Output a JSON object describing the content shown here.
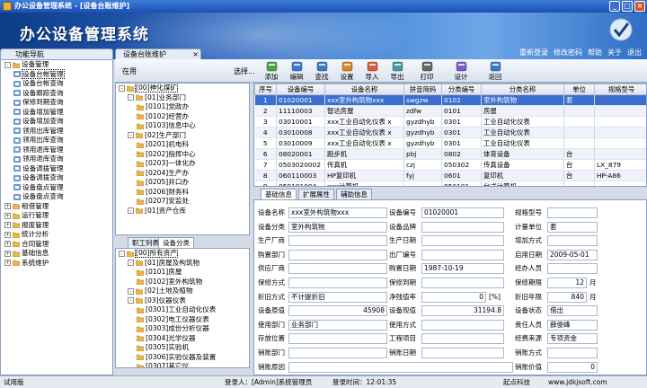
{
  "window": {
    "title": "办公设备管理系统 - [设备台账维护]"
  },
  "banner": {
    "app_title": "办公设备管理系统",
    "nav": [
      "重新登录",
      "修改密码",
      "帮助",
      "关于",
      "退出"
    ]
  },
  "nav": {
    "title": "功能导航",
    "tree": [
      {
        "label": "设备管理",
        "level": 0,
        "exp": "-"
      },
      {
        "label": "设备台帐管理",
        "level": 1,
        "sel": true
      },
      {
        "label": "设备台帐查询",
        "level": 1
      },
      {
        "label": "设备跟踪查询",
        "level": 1
      },
      {
        "label": "保修到期查询",
        "level": 1
      },
      {
        "label": "设备增加管理",
        "level": 1
      },
      {
        "label": "设备增加查询",
        "level": 1
      },
      {
        "label": "领用出库管理",
        "level": 1
      },
      {
        "label": "领用出库查询",
        "level": 1
      },
      {
        "label": "领用退库管理",
        "level": 1
      },
      {
        "label": "领用退库查询",
        "level": 1
      },
      {
        "label": "设备调拨管理",
        "level": 1
      },
      {
        "label": "设备调拨查询",
        "level": 1
      },
      {
        "label": "设备盘点管理",
        "level": 1
      },
      {
        "label": "设备盘点查询",
        "level": 1
      },
      {
        "label": "租借管理",
        "level": 0,
        "exp": "+"
      },
      {
        "label": "运行管理",
        "level": 0,
        "exp": "+"
      },
      {
        "label": "报废管理",
        "level": 0,
        "exp": "+"
      },
      {
        "label": "统计分析",
        "level": 0,
        "exp": "+"
      },
      {
        "label": "合同管理",
        "level": 0,
        "exp": "+"
      },
      {
        "label": "基础信息",
        "level": 0,
        "exp": "+"
      },
      {
        "label": "系统维护",
        "level": 0,
        "exp": "+"
      }
    ]
  },
  "main_tab": "设备台账维护",
  "toolbar": {
    "search_label": "在用",
    "browse": "选择...",
    "tools": [
      "添加",
      "编辑",
      "查找",
      "设置",
      "导入",
      "导出",
      "打印",
      "设计",
      "返回"
    ]
  },
  "dept_tree": [
    {
      "label": "[00]神化煤矿",
      "level": 0,
      "sel": true
    },
    {
      "label": "[01]业务部门",
      "level": 1
    },
    {
      "label": "[0101]党政办",
      "level": 2
    },
    {
      "label": "[0102]经营办",
      "level": 2
    },
    {
      "label": "[0103]信息中心",
      "level": 2
    },
    {
      "label": "[02]生产部门",
      "level": 1
    },
    {
      "label": "[0201]机电科",
      "level": 2
    },
    {
      "label": "[0202]指挥中心",
      "level": 2
    },
    {
      "label": "[0203]一体化办",
      "level": 2
    },
    {
      "label": "[0204]生产办",
      "level": 2
    },
    {
      "label": "[0205]井口办",
      "level": 2
    },
    {
      "label": "[0206]财务科",
      "level": 2
    },
    {
      "label": "[0207]安监处",
      "level": 2
    },
    {
      "label": "[01]资产仓库",
      "level": 1
    }
  ],
  "left_tabs": [
    "职工列表",
    "设备分类"
  ],
  "cat_tree": [
    {
      "label": "[00]所有资产",
      "level": 0,
      "sel": true
    },
    {
      "label": "[01]房屋及构筑物",
      "level": 1
    },
    {
      "label": "[0101]房屋",
      "level": 2
    },
    {
      "label": "[0102]室外构筑物",
      "level": 2
    },
    {
      "label": "[02]土地及植物",
      "level": 1
    },
    {
      "label": "[03]仪器仪表",
      "level": 1
    },
    {
      "label": "[0301]工业自动化仪表",
      "level": 2
    },
    {
      "label": "[0302]电工仪器仪表",
      "level": 2
    },
    {
      "label": "[0303]成份分析仪器",
      "level": 2
    },
    {
      "label": "[0304]光学仪器",
      "level": 2
    },
    {
      "label": "[0305]实验机",
      "level": 2
    },
    {
      "label": "[0306]实验仪器及装置",
      "level": 2
    },
    {
      "label": "[0307]其它仪",
      "level": 2
    }
  ],
  "grid": {
    "headers": [
      "序号",
      "设备编号",
      "设备名称",
      "拼音简码",
      "分类编号",
      "分类名称",
      "单位",
      "规格型号"
    ],
    "rows": [
      [
        "1",
        "01020001",
        "xxx室外构筑物xxx",
        "swgzw",
        "0102",
        "室外构筑物",
        "套",
        ""
      ],
      [
        "2",
        "11110003",
        "智达房屋",
        "zdfw",
        "0101",
        "房屋",
        "",
        ""
      ],
      [
        "3",
        "03010001",
        "xxx工业自动化仪表 x",
        "gyzdhyb",
        "0301",
        "工业自动化仪表",
        "",
        ""
      ],
      [
        "4",
        "03010008",
        "xxx工业自动化仪表 x",
        "gyzdhyb",
        "0301",
        "工业自动化仪表",
        "",
        ""
      ],
      [
        "5",
        "03010009",
        "xxx工业自动化仪表 x",
        "gyzdhyb",
        "0301",
        "工业自动化仪表",
        "",
        ""
      ],
      [
        "6",
        "08020001",
        "跑步机",
        "pbj",
        "0802",
        "体育设备",
        "台",
        ""
      ],
      [
        "7",
        "0503020002",
        "传真机",
        "czj",
        "050302",
        "传真设备",
        "台",
        "LX_879"
      ],
      [
        "8",
        "060110003",
        "HP复印机",
        "fyj",
        "0601",
        "复印机",
        "台",
        "HP-A86"
      ],
      [
        "9",
        "050101004",
        "xxx计算机",
        "",
        "050101",
        "台式计算机",
        "",
        ""
      ]
    ]
  },
  "detail_tabs": [
    "基础信息",
    "扩展属性",
    "辅助信息"
  ],
  "detail": {
    "r1": {
      "l1": "设备名称",
      "v1": "xxx室外构筑物xxx",
      "l2": "设备编号",
      "v2": "01020001",
      "l3": "规格型号",
      "v3": ""
    },
    "r2": {
      "l1": "设备分类",
      "v1": "室外构筑物",
      "l2": "设备品牌",
      "v2": "",
      "l3": "计量单位",
      "v3": "套"
    },
    "r3": {
      "l1": "生产厂商",
      "v1": "",
      "l2": "生产日期",
      "v2": "",
      "l3": "增加方式",
      "v3": ""
    },
    "r4": {
      "l1": "购置部门",
      "v1": "",
      "l2": "出厂编号",
      "v2": "",
      "l3": "启用日期",
      "v3": "2009-05-01"
    },
    "r5": {
      "l1": "供应厂商",
      "v1": "",
      "l2": "购置日期",
      "v2": "1987-10-19",
      "l3": "经办人员",
      "v3": ""
    },
    "r6": {
      "l1": "保修方式",
      "v1": "",
      "l2": "保修到期",
      "v2": "",
      "l3": "保修期限",
      "v3": "12",
      "u3": "月"
    },
    "r7": {
      "l1": "折旧方式",
      "v1": "不计提折旧",
      "l2": "净残值率",
      "v2": "0",
      "u2": "[%]",
      "l3": "折旧年限",
      "v3": "840",
      "u3": "月"
    },
    "r8": {
      "l1": "设备原值",
      "v1": "45908",
      "l2": "设备现值",
      "v2": "31194.8",
      "l3": "设备状态",
      "v3": "借出"
    },
    "r9": {
      "l1": "使用部门",
      "v1": "业务部门",
      "l2": "使用方式",
      "v2": "",
      "l3": "责任人员",
      "v3": "薛俊峰"
    },
    "r10": {
      "l1": "存放位置",
      "v1": "",
      "l2": "工程项目",
      "v2": "",
      "l3": "经费来源",
      "v3": "专项资金"
    },
    "r11": {
      "l1": "销账部门",
      "v1": "",
      "l2": "销账日期",
      "v2": "",
      "l3": "销账方式",
      "v3": ""
    },
    "r12": {
      "l1": "销账原因",
      "v1": "",
      "l3": "销账价值",
      "v3": "0"
    }
  },
  "status": {
    "left": "试用版",
    "user": "登录人：[Admin]系统管理员",
    "time": "登录时间：12:01:35",
    "company": "起点科技",
    "url": "www.jdkjsoft.com"
  }
}
